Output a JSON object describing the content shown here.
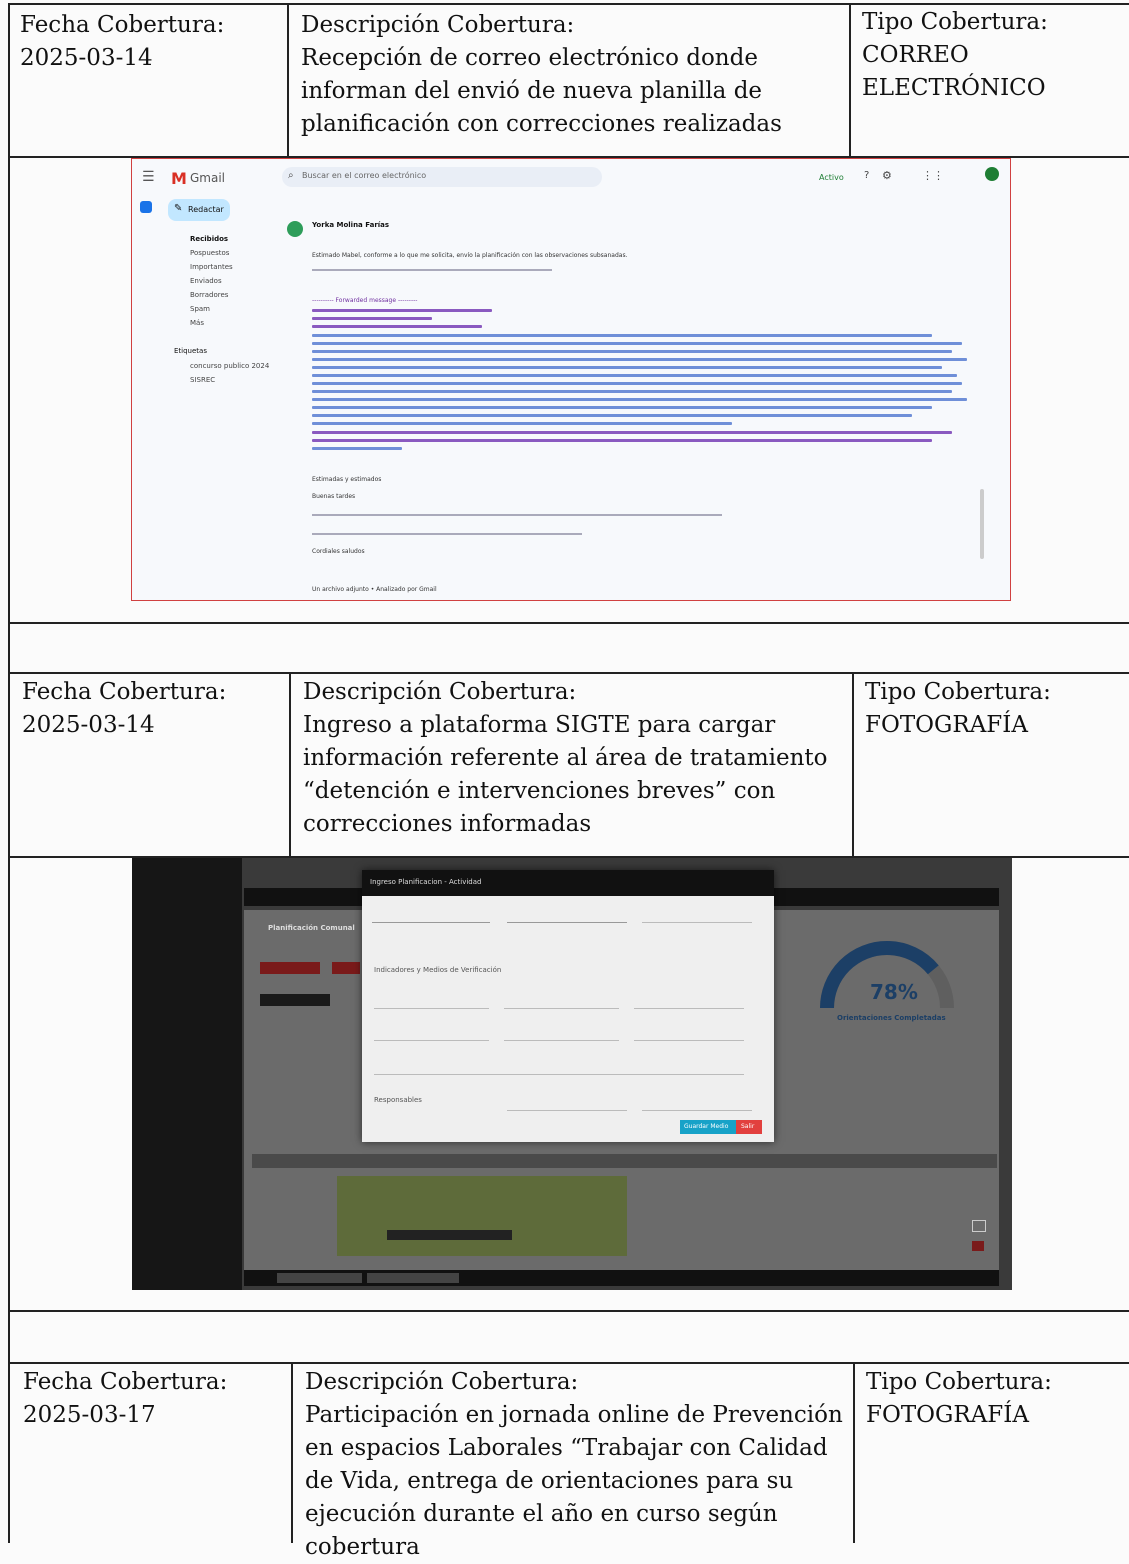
{
  "rows": [
    {
      "fecha_label": "Fecha Cobertura:",
      "fecha": "2025-03-14",
      "desc_label": "Descripción Cobertura:",
      "desc": "Recepción de correo electrónico donde informan del envió de nueva planilla de planificación con correcciones realizadas",
      "tipo_label": "Tipo Cobertura:",
      "tipo": "CORREO ELECTRÓNICO"
    },
    {
      "fecha_label": "Fecha Cobertura:",
      "fecha": "2025-03-14",
      "desc_label": "Descripción Cobertura:",
      "desc": "Ingreso a plataforma SIGTE para cargar información referente al área de tratamiento “detención e intervenciones breves” con correcciones informadas",
      "tipo_label": "Tipo Cobertura:",
      "tipo": "FOTOGRAFÍA"
    },
    {
      "fecha_label": "Fecha Cobertura:",
      "fecha": "2025-03-17",
      "desc_label": "Descripción Cobertura:",
      "desc": "Participación en jornada online de Prevención en espacios Laborales “Trabajar con Calidad de Vida, entrega de orientaciones para su ejecución durante el año en curso según cobertura",
      "tipo_label": "Tipo Cobertura:",
      "tipo": "FOTOGRAFÍA"
    }
  ],
  "gmail": {
    "logo": "Gmail",
    "search_placeholder": "Buscar en el correo electrónico",
    "status": "Activo",
    "compose": "Redactar",
    "nav": [
      "Recibidos",
      "Pospuestos",
      "Importantes",
      "Enviados",
      "Borradores",
      "Spam",
      "Más"
    ],
    "labels_title": "Etiquetas",
    "labels": [
      "concurso publico 2024",
      "SISREC"
    ],
    "sender": "Yorka Molina Farías",
    "body_intro": "Estimado Mabel, conforme a lo que me solicita, envío la planificación con las observaciones subsanadas.",
    "forwarded": "---------- Forwarded message ---------",
    "closing_1": "Estimadas y estimados",
    "closing_2": "Buenas tardes",
    "closing_3": "Cordiales saludos",
    "attachment": "Un archivo adjunto • Analizado por Gmail"
  },
  "sigte": {
    "modal_title": "Ingreso Planificacion - Actividad",
    "section_indicators": "Indicadores y Medios de Verificación",
    "section_responsables": "Responsables",
    "btn_save": "Guardar Medio",
    "btn_close": "Salir",
    "gauge_value": "78%",
    "gauge_label": "Orientaciones Completadas",
    "panel_title": "Planificación Comunal",
    "gauge_fraction": 0.78
  }
}
